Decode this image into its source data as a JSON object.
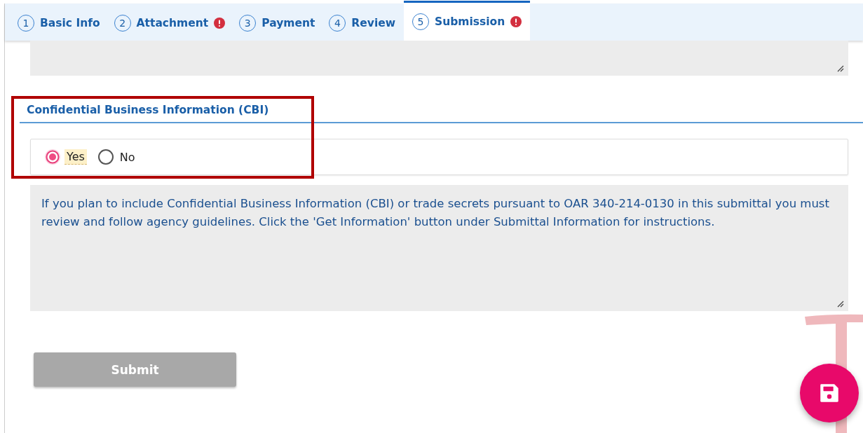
{
  "tabs": [
    {
      "number": "1",
      "label": "Basic Info",
      "selected": false,
      "error": false
    },
    {
      "number": "2",
      "label": "Attachment",
      "selected": false,
      "error": true
    },
    {
      "number": "3",
      "label": "Payment",
      "selected": false,
      "error": false
    },
    {
      "number": "4",
      "label": "Review",
      "selected": false,
      "error": false
    },
    {
      "number": "5",
      "label": "Submission",
      "selected": true,
      "error": true
    }
  ],
  "cbi": {
    "heading": "Confidential Business Information (CBI)",
    "highlighted": true,
    "options": [
      {
        "label": "Yes",
        "selected": true
      },
      {
        "label": "No",
        "selected": false
      }
    ],
    "info": "If you plan to include Confidential Business Information (CBI) or trade secrets pursuant to OAR 340-214-0130 in this submittal you must review and follow agency guidelines. Click the 'Get Information' button under Submittal Information for instructions."
  },
  "submit_button": {
    "label": "Submit",
    "disabled": true
  }
}
